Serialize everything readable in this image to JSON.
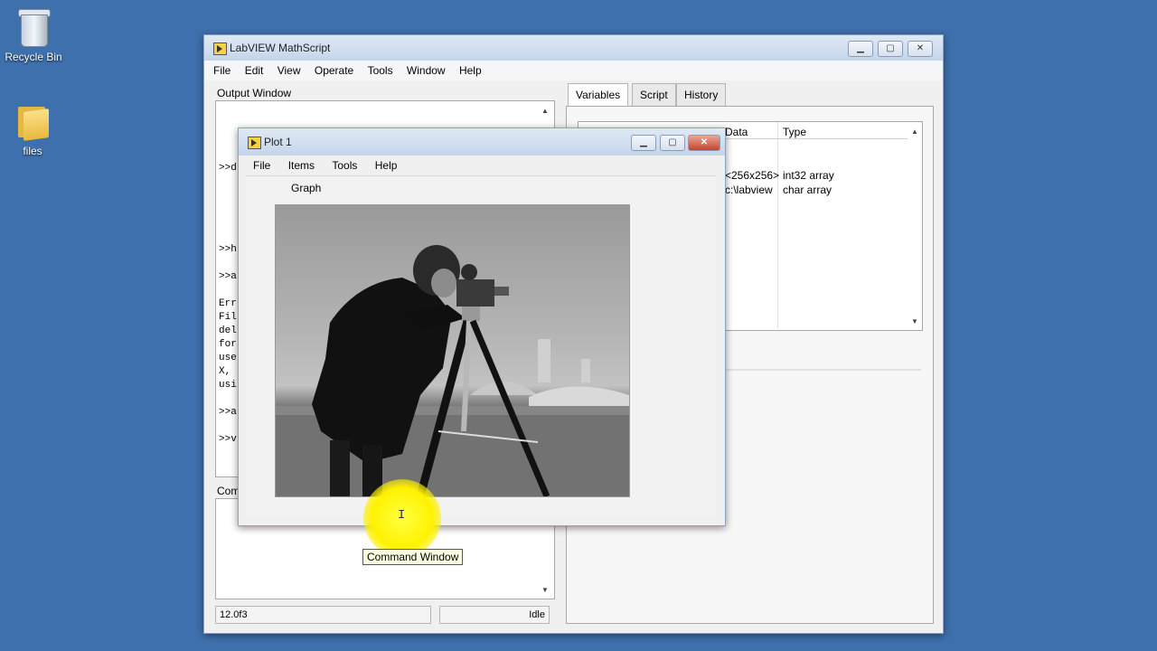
{
  "desktop": {
    "icons": [
      {
        "label": "Recycle Bin",
        "icon": "recycle-bin-icon"
      },
      {
        "label": "files",
        "icon": "folder-icon"
      }
    ]
  },
  "main_window": {
    "title": "LabVIEW MathScript",
    "menu": [
      "File",
      "Edit",
      "View",
      "Operate",
      "Tools",
      "Window",
      "Help"
    ],
    "output_label": "Output Window",
    "output_lines": [
      ">>d",
      ">>h",
      ">>a",
      "Err",
      "Fil",
      "del",
      "for",
      "use",
      "X,",
      "usi",
      ">>a",
      ">>v"
    ],
    "command_label": "Com",
    "tabs": [
      "Variables",
      "Script",
      "History"
    ],
    "active_tab": "Variables",
    "variables_columns": [
      "Data",
      "Type"
    ],
    "variables_rows": [
      {
        "data": "<256x256>",
        "type": "int32 array"
      },
      {
        "data": "c:\\labview",
        "type": "char array"
      }
    ],
    "status_left": "12.0f3",
    "status_right": "Idle"
  },
  "plot_window": {
    "title": "Plot 1",
    "menu": [
      "File",
      "Items",
      "Tools",
      "Help"
    ],
    "graph_label": "Graph"
  },
  "tooltip": "Command Window"
}
